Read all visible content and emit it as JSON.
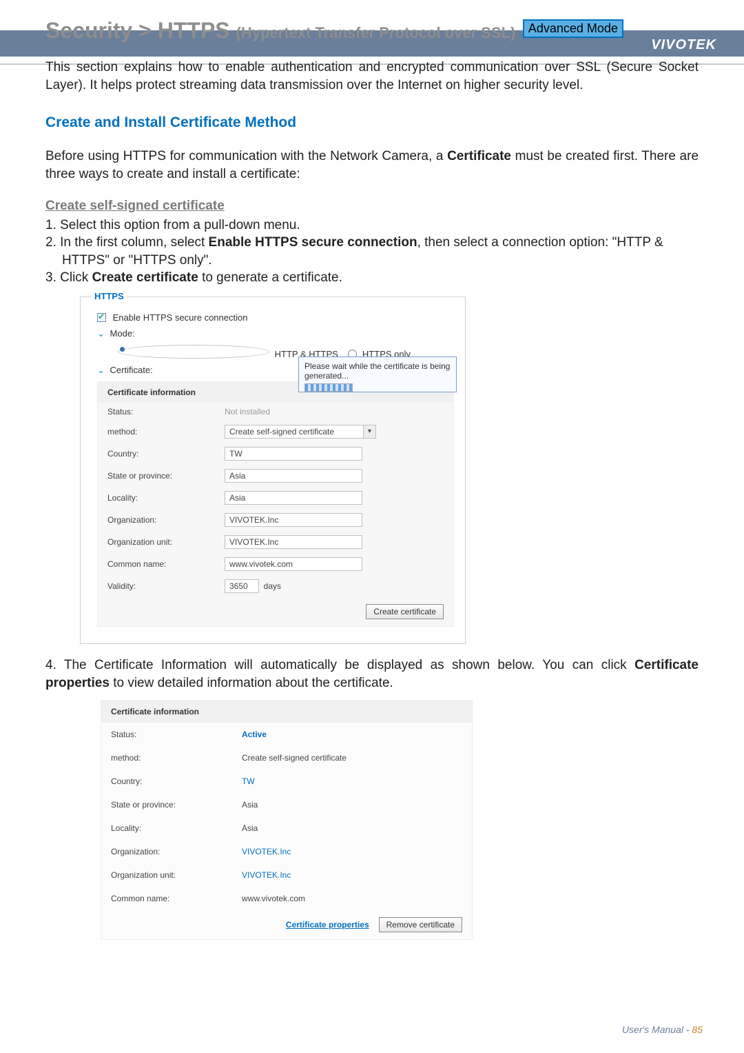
{
  "header": {
    "brand": "VIVOTEK"
  },
  "title": {
    "main": "Security >  HTTPS ",
    "sub": "(Hypertext Transfer Protocol over SSL)",
    "badge": "Advanced Mode"
  },
  "intro": "This section explains how to enable authentication and encrypted communication over SSL (Secure Socket Layer). It helps protect streaming data transmission over the Internet on higher security level.",
  "section_heading": "Create and Install Certificate Method",
  "before": {
    "pre": "Before using HTTPS for communication with the Network Camera, a",
    "bold": "Certificate",
    "post": "must be created first. There are three ways to create and install a certificate:"
  },
  "subsection": "Create self-signed certificate",
  "steps": [
    "1. Select this option from a pull-down menu.",
    {
      "pre": "2. In the first column, select",
      "bold": "Enable HTTPS secure connection",
      "post": ", then select a connection option: \"HTTP & HTTPS\" or \"HTTPS only\"."
    },
    {
      "pre": "3. Click",
      "bold": "Create certificate",
      "post": "to generate a certificate."
    }
  ],
  "fig1": {
    "legend": "HTTPS",
    "enable_label": "Enable HTTPS secure connection",
    "mode_label": "Mode:",
    "mode_opt1": "HTTP & HTTPS",
    "mode_opt2": "HTTPS only",
    "cert_label": "Certificate:",
    "popup_text": "Please wait while the certificate is being generated...",
    "panel": {
      "header": "Certificate information",
      "rows": [
        {
          "label": "Status:",
          "value": "Not installed"
        },
        {
          "label": "method:",
          "value": "Create self-signed certificate"
        },
        {
          "label": "Country:",
          "value": "TW"
        },
        {
          "label": "State or province:",
          "value": "Asia"
        },
        {
          "label": "Locality:",
          "value": "Asia"
        },
        {
          "label": "Organization:",
          "value": "VIVOTEK.Inc"
        },
        {
          "label": "Organization unit:",
          "value": "VIVOTEK.Inc"
        },
        {
          "label": "Common name:",
          "value": "www.vivotek.com"
        },
        {
          "label": "Validity:",
          "value": "3650",
          "unit": "days"
        }
      ],
      "button": "Create certificate"
    }
  },
  "step4": {
    "pre": "4. The Certificate Information will automatically be displayed as shown below. You can click",
    "bold": "Certificate properties",
    "post": "to view detailed information about the certificate."
  },
  "fig2": {
    "header": "Certificate information",
    "rows": [
      {
        "label": "Status:",
        "value": "Active"
      },
      {
        "label": "method:",
        "value": "Create self-signed certificate"
      },
      {
        "label": "Country:",
        "value": "TW"
      },
      {
        "label": "State or province:",
        "value": "Asia"
      },
      {
        "label": "Locality:",
        "value": "Asia"
      },
      {
        "label": "Organization:",
        "value": "VIVOTEK.Inc"
      },
      {
        "label": "Organization unit:",
        "value": "VIVOTEK.Inc"
      },
      {
        "label": "Common name:",
        "value": "www.vivotek.com"
      }
    ],
    "link": "Certificate properties",
    "button": "Remove certificate"
  },
  "footer": {
    "label": "User's Manual -",
    "page": "85"
  }
}
